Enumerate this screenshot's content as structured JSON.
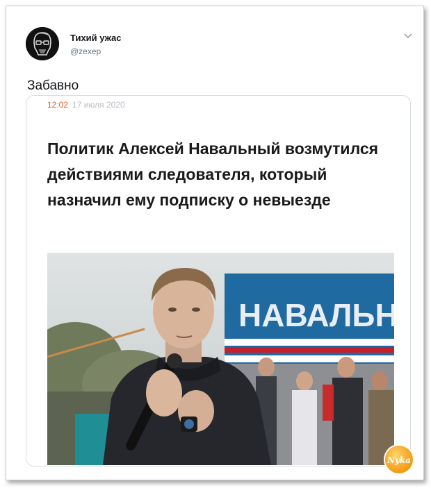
{
  "tweet": {
    "display_name": "Тихий ужас",
    "handle": "@zexep",
    "text": "Забавно",
    "menu_icon": "chevron-down-icon"
  },
  "card": {
    "time": "12:02",
    "date": "17 июля 2020",
    "headline": "Политик Алексей Навальный возмутился действиями следователя, который назначил ему подписку о невыезде",
    "banner_text": "НАВАЛЬН"
  },
  "watermark": {
    "text": "Nyka"
  },
  "colors": {
    "time_accent": "#e0632c",
    "banner_blue": "#1f6aa0",
    "banner_stripe": "#c8202a"
  }
}
